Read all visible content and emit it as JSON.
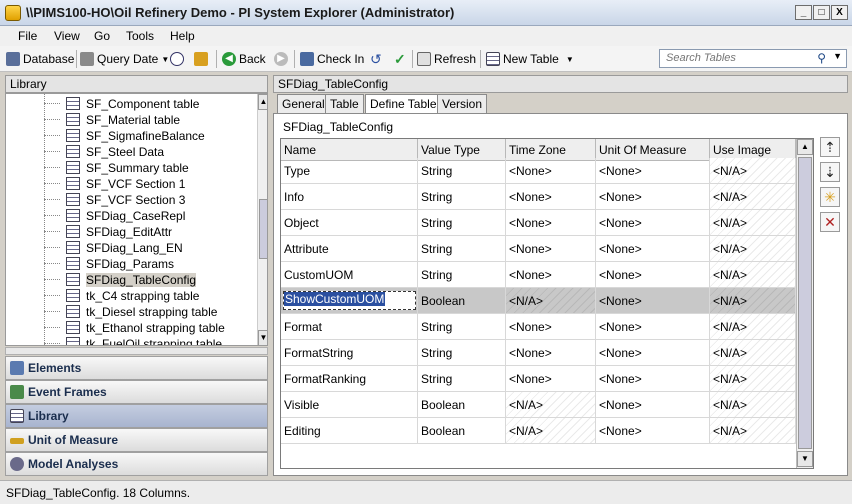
{
  "window": {
    "title": "\\\\PIMS100-HO\\Oil Refinery Demo - PI System Explorer (Administrator)",
    "min": "_",
    "max": "□",
    "close": "X"
  },
  "menu": [
    "File",
    "View",
    "Go",
    "Tools",
    "Help"
  ],
  "toolbar": {
    "database": "Database",
    "query_date": "Query Date",
    "back": "Back",
    "check_in": "Check In",
    "refresh": "Refresh",
    "new_table": "New Table",
    "search_placeholder": "Search Tables"
  },
  "left_pane": {
    "header": "Library",
    "tree": [
      "SF_Component table",
      "SF_Material table",
      "SF_SigmafineBalance",
      "SF_Steel Data",
      "SF_Summary table",
      "SF_VCF Section 1",
      "SF_VCF Section 3",
      "SFDiag_CaseRepl",
      "SFDiag_EditAttr",
      "SFDiag_Lang_EN",
      "SFDiag_Params",
      "SFDiag_TableConfig",
      "tk_C4 strapping table",
      "tk_Diesel strapping table",
      "tk_Ethanol strapping table",
      "tk_FuelOil strapping table"
    ],
    "selected": "SFDiag_TableConfig",
    "nav": [
      "Elements",
      "Event Frames",
      "Library",
      "Unit of Measure",
      "Model Analyses"
    ],
    "nav_active": "Library"
  },
  "right_pane": {
    "header": "SFDiag_TableConfig",
    "tabs": [
      "General",
      "Table",
      "Define Table",
      "Version"
    ],
    "active_tab": "Define Table",
    "panel_title": "SFDiag_TableConfig",
    "columns": [
      "Name",
      "Value Type",
      "Time Zone",
      "Unit Of Measure",
      "Use Image"
    ],
    "rows": [
      [
        "Type",
        "String",
        "<None>",
        "<None>",
        "<N/A>"
      ],
      [
        "Info",
        "String",
        "<None>",
        "<None>",
        "<N/A>"
      ],
      [
        "Object",
        "String",
        "<None>",
        "<None>",
        "<N/A>"
      ],
      [
        "Attribute",
        "String",
        "<None>",
        "<None>",
        "<N/A>"
      ],
      [
        "CustomUOM",
        "String",
        "<None>",
        "<None>",
        "<N/A>"
      ],
      [
        "ShowCustomUOM",
        "Boolean",
        "<N/A>",
        "<None>",
        "<N/A>"
      ],
      [
        "Format",
        "String",
        "<None>",
        "<None>",
        "<N/A>"
      ],
      [
        "FormatString",
        "String",
        "<None>",
        "<None>",
        "<N/A>"
      ],
      [
        "FormatRanking",
        "String",
        "<None>",
        "<None>",
        "<N/A>"
      ],
      [
        "Visible",
        "Boolean",
        "<N/A>",
        "<None>",
        "<N/A>"
      ],
      [
        "Editing",
        "Boolean",
        "<N/A>",
        "<None>",
        "<N/A>"
      ]
    ],
    "selected_row": 5
  },
  "status": "SFDiag_TableConfig. 18 Columns.",
  "colors": {
    "accent": "#2a4fa0",
    "nav_active": "#a8b4cf"
  }
}
